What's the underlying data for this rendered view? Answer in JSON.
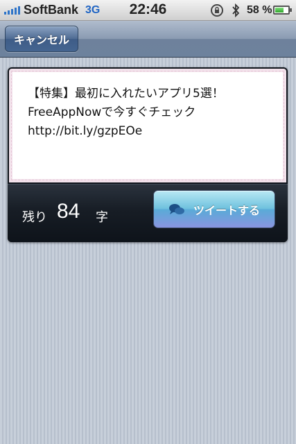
{
  "status_bar": {
    "carrier": "SoftBank",
    "network": "3G",
    "time": "22:46",
    "battery_percent": "58 %",
    "battery_level": 0.58,
    "icons": [
      "signal-bars-icon",
      "rotation-lock-icon",
      "bluetooth-icon",
      "battery-icon"
    ]
  },
  "nav": {
    "cancel_label": "キャンセル"
  },
  "compose": {
    "text": "【特集】最初に入れたいアプリ5選！\nFreeAppNowで今すぐチェック\nhttp://bit.ly/gzpEOe",
    "remaining_label": "残り",
    "remaining_count": "84",
    "remaining_unit": "字",
    "tweet_button_label": "ツイートする",
    "tweet_button_icon": "chat-bubbles-icon"
  },
  "colors": {
    "nav_bar": "#6e819c",
    "tweet_button": "#5aaad7",
    "network_3g": "#1f64c4"
  }
}
